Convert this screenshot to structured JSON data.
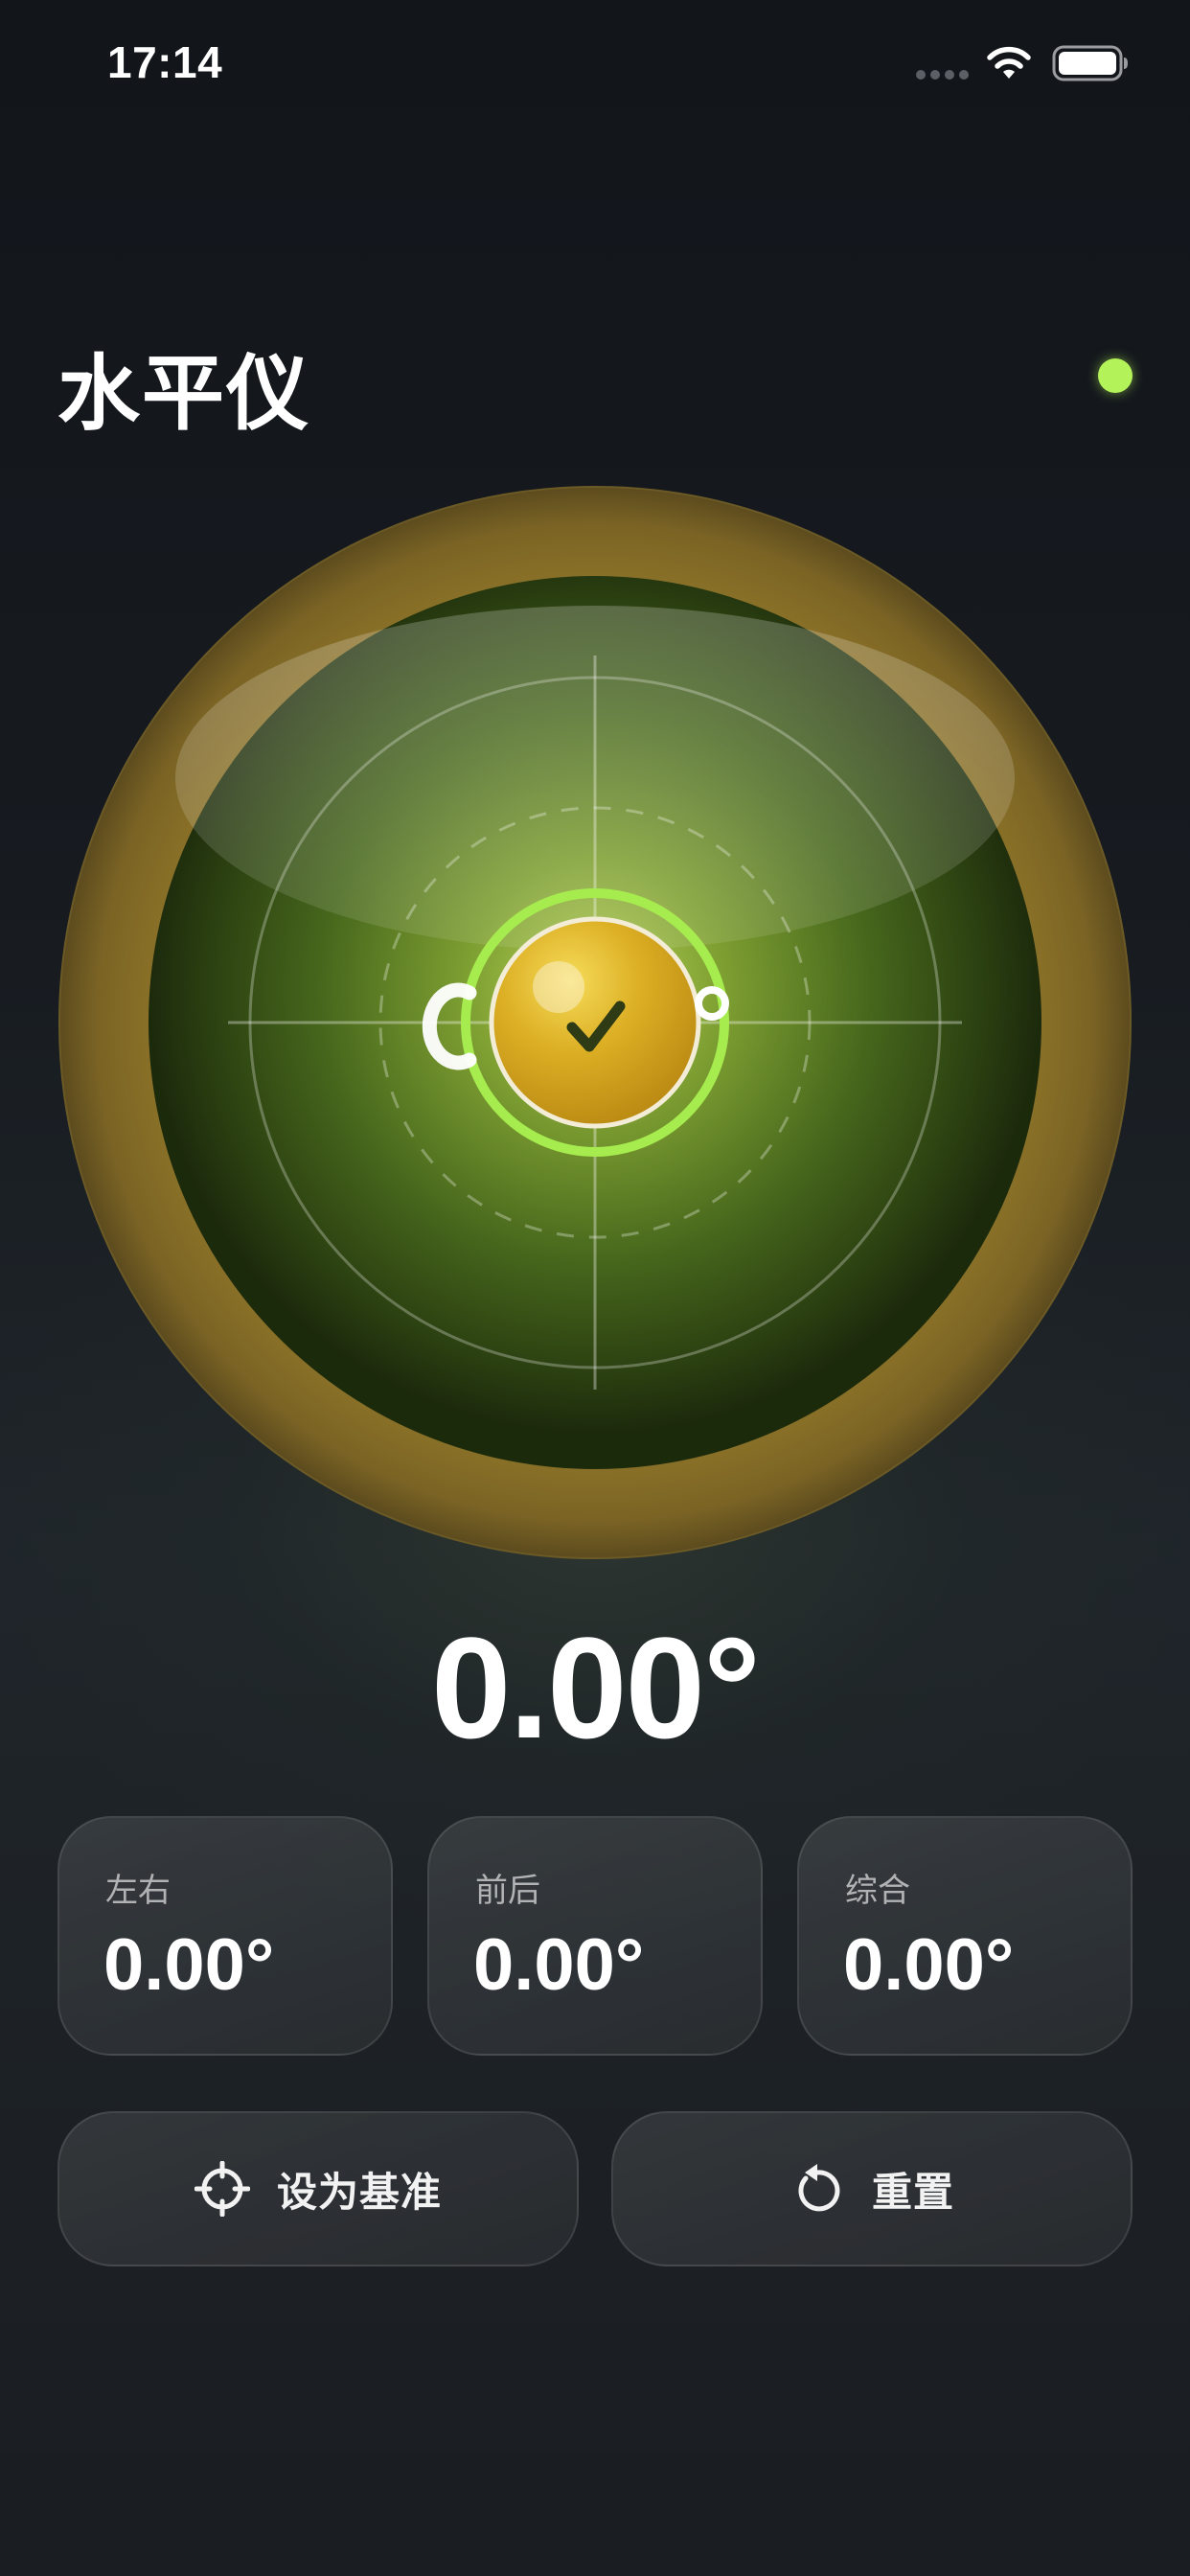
{
  "status_bar": {
    "time": "17:14"
  },
  "header": {
    "title": "水平仪",
    "indicator_color": "#b4f25a"
  },
  "level": {
    "bubble_offset_x": 0,
    "bubble_offset_y": 0,
    "bubble_ring_color": "#a6ec4f",
    "bubble_color": "#e0b324",
    "ring_color": "#8a7228"
  },
  "main_reading": "0.00°",
  "cards": [
    {
      "label": "左右",
      "value": "0.00°"
    },
    {
      "label": "前后",
      "value": "0.00°"
    },
    {
      "label": "综合",
      "value": "0.00°"
    }
  ],
  "actions": {
    "set_baseline": {
      "label": "设为基准",
      "icon": "crosshair-icon"
    },
    "reset": {
      "label": "重置",
      "icon": "reset-icon"
    }
  }
}
